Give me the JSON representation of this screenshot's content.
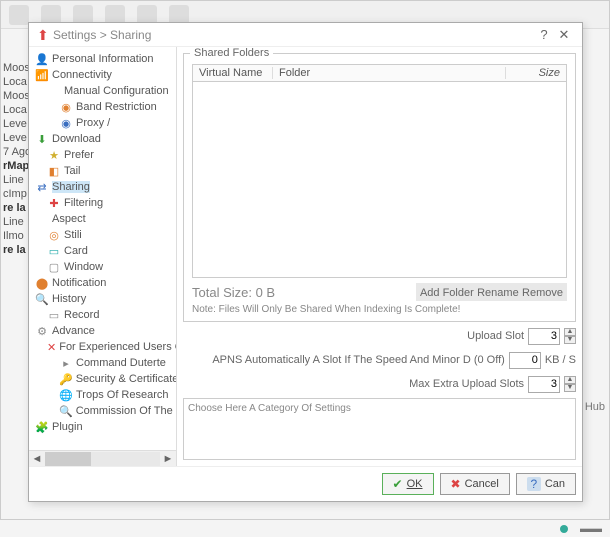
{
  "dialog": {
    "title": "Settings > Sharing",
    "help": "?",
    "close": "✕"
  },
  "tree": {
    "items": [
      {
        "label": "Personal Information",
        "icon": "👤",
        "cls": "green",
        "lvl": 1
      },
      {
        "label": "Connectivity",
        "icon": "📶",
        "cls": "blue",
        "lvl": 1
      },
      {
        "label": "Manual Configuration",
        "icon": "",
        "cls": "",
        "lvl": 2
      },
      {
        "label": "Band Restriction",
        "icon": "◉",
        "cls": "orange",
        "lvl": 3
      },
      {
        "label": "Proxy /",
        "icon": "◉",
        "cls": "blue",
        "lvl": 3
      },
      {
        "label": "Download",
        "icon": "⬇",
        "cls": "green",
        "lvl": 1
      },
      {
        "label": "Prefer",
        "icon": "★",
        "cls": "yellow",
        "lvl": 2
      },
      {
        "label": "Tail",
        "icon": "◧",
        "cls": "orange",
        "lvl": 2
      },
      {
        "label": "Sharing",
        "icon": "⇄",
        "cls": "blue",
        "lvl": 1,
        "sel": true
      },
      {
        "label": "Filtering",
        "icon": "✚",
        "cls": "red",
        "lvl": 2
      },
      {
        "label": "Aspect",
        "icon": "",
        "cls": "",
        "lvl": 1
      },
      {
        "label": "Stili",
        "icon": "◎",
        "cls": "orange",
        "lvl": 2
      },
      {
        "label": "Card",
        "icon": "▭",
        "cls": "teal",
        "lvl": 2
      },
      {
        "label": "Window",
        "icon": "▢",
        "cls": "gray",
        "lvl": 2
      },
      {
        "label": "Notification",
        "icon": "⬤",
        "cls": "orange",
        "lvl": 1
      },
      {
        "label": "History",
        "icon": "🔍",
        "cls": "gray",
        "lvl": 1
      },
      {
        "label": "Record",
        "icon": "▭",
        "cls": "gray",
        "lvl": 2
      },
      {
        "label": "Advance",
        "icon": "⚙",
        "cls": "gray",
        "lvl": 1
      },
      {
        "label": "For Experienced Users Only",
        "icon": "✕",
        "cls": "red",
        "lvl": 2
      },
      {
        "label": "Command Duterte",
        "icon": "▸",
        "cls": "gray",
        "lvl": 3
      },
      {
        "label": "Security & Certificates",
        "icon": "🔑",
        "cls": "yellow",
        "lvl": 3
      },
      {
        "label": "Trops Of Research",
        "icon": "🌐",
        "cls": "teal",
        "lvl": 3
      },
      {
        "label": "Commission Of The European Communities",
        "icon": "🔍",
        "cls": "gray",
        "lvl": 3
      },
      {
        "label": "Plugin",
        "icon": "🧩",
        "cls": "blue",
        "lvl": 1
      }
    ]
  },
  "shared": {
    "group_title": "Shared Folders",
    "col_virtual": "Virtual Name",
    "col_folder": "Folder",
    "col_size": "Size",
    "total": "Total Size: 0 B",
    "add": "Add Folder",
    "rename": "Rename",
    "remove": "Remove",
    "note": "Note: Files Will Only Be Shared When Indexing Is Complete!"
  },
  "slots": {
    "upload_label": "Upload Slot",
    "upload_val": "3",
    "apns": "APNS Automatically A Slot If The Speed And Minor D (0 Off)",
    "apns_val": "0",
    "apns_suffix": "KB / S",
    "maxextra": "Max Extra Upload Slots",
    "maxextra_val": "3"
  },
  "desc": {
    "placeholder": "Choose Here A Category Of Settings"
  },
  "buttons": {
    "ok": "OK",
    "cancel": "Cancel",
    "help": "Can"
  },
  "bg": {
    "side": [
      "Moos",
      "Loca",
      "Moos",
      "Loca",
      "Leve",
      "Leve",
      "7 Ago",
      "rMap",
      "Line",
      "cImp",
      "re la r",
      "Line",
      "Ilmo",
      "re la r"
    ],
    "hub": "Hub"
  }
}
